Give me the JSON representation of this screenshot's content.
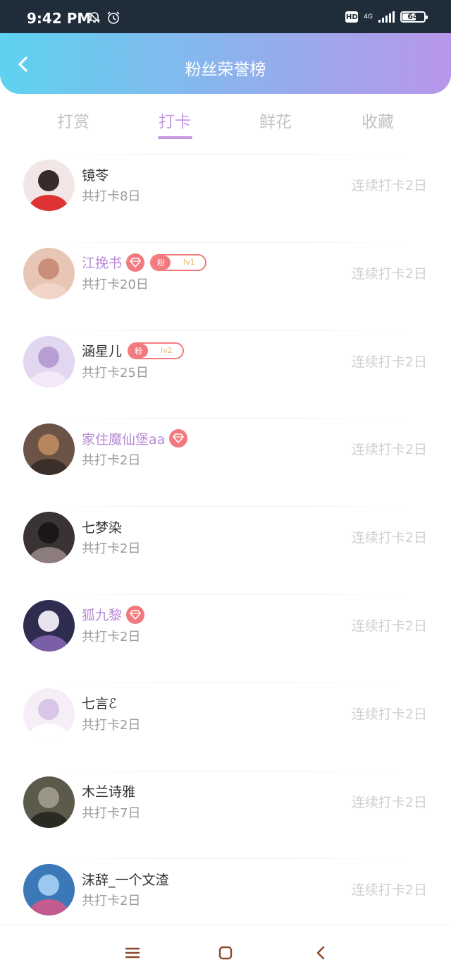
{
  "status_bar": {
    "time": "9:42 PM",
    "icons": [
      "bell-off-icon",
      "alarm-icon"
    ],
    "hd": "HD",
    "network": "4G",
    "battery": "64",
    "battery_level": 0.64
  },
  "header": {
    "title": "粉丝荣誉榜",
    "back_icon": "chevron-left-icon"
  },
  "tabs": [
    {
      "label": "打赏",
      "active": false
    },
    {
      "label": "打卡",
      "active": true
    },
    {
      "label": "鲜花",
      "active": false
    },
    {
      "label": "收藏",
      "active": false
    }
  ],
  "colors": {
    "accent": "#c69be6",
    "vip_name": "#b78ad8",
    "badge": "#f27a7e",
    "header_start": "#5ed2f0",
    "header_end": "#b897ea"
  },
  "rows": [
    {
      "name": "镜苓",
      "vip": false,
      "diamond": false,
      "fan_label": null,
      "fan_level": null,
      "total": "共打卡8日",
      "streak": "连续打卡2日"
    },
    {
      "name": "江挽书",
      "vip": true,
      "diamond": true,
      "fan_label": "粉",
      "fan_level": "lv1",
      "total": "共打卡20日",
      "streak": "连续打卡2日"
    },
    {
      "name": "涵星儿",
      "vip": false,
      "diamond": false,
      "fan_label": "粉",
      "fan_level": "lv2",
      "total": "共打卡25日",
      "streak": "连续打卡2日"
    },
    {
      "name": "家住魔仙堡aa",
      "vip": true,
      "diamond": true,
      "fan_label": null,
      "fan_level": null,
      "total": "共打卡2日",
      "streak": "连续打卡2日"
    },
    {
      "name": "七梦染",
      "vip": false,
      "diamond": false,
      "fan_label": null,
      "fan_level": null,
      "total": "共打卡2日",
      "streak": "连续打卡2日"
    },
    {
      "name": "狐九黎",
      "vip": true,
      "diamond": true,
      "fan_label": null,
      "fan_level": null,
      "total": "共打卡2日",
      "streak": "连续打卡2日"
    },
    {
      "name": "七言ℰ",
      "vip": false,
      "diamond": false,
      "fan_label": null,
      "fan_level": null,
      "total": "共打卡2日",
      "streak": "连续打卡2日"
    },
    {
      "name": "木兰诗雅",
      "vip": false,
      "diamond": false,
      "fan_label": null,
      "fan_level": null,
      "total": "共打卡7日",
      "streak": "连续打卡2日"
    },
    {
      "name": "沫辞_一个文渣",
      "vip": false,
      "diamond": false,
      "fan_label": null,
      "fan_level": null,
      "total": "共打卡2日",
      "streak": "连续打卡2日"
    }
  ],
  "nav_bar": {
    "icons": [
      "menu-icon",
      "home-square-icon",
      "back-triangle-icon"
    ]
  }
}
